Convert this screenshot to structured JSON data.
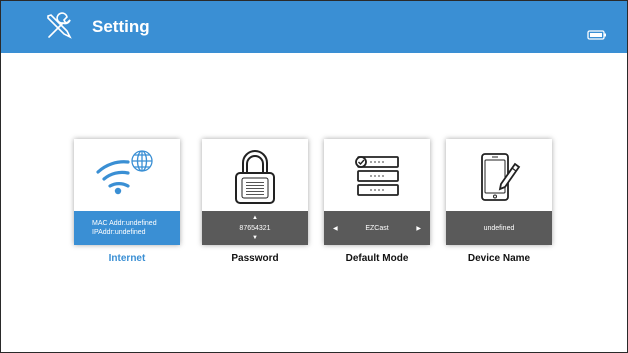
{
  "header": {
    "title": "Setting",
    "icon": "tools-icon",
    "status_icon": "battery-icon",
    "background": "#3a8fd4"
  },
  "cards": [
    {
      "id": "internet",
      "icon": "wifi-globe-icon",
      "label": "Internet",
      "line1": "MAC Addr:undefined",
      "line2": "IPAddr:undefined",
      "active": true
    },
    {
      "id": "password",
      "icon": "lock-icon",
      "label": "Password",
      "value": "87654321"
    },
    {
      "id": "default-mode",
      "icon": "list-icon",
      "label": "Default Mode",
      "value": "EZCast"
    },
    {
      "id": "device-name",
      "icon": "phone-edit-icon",
      "label": "Device Name",
      "value": "undefined"
    }
  ]
}
